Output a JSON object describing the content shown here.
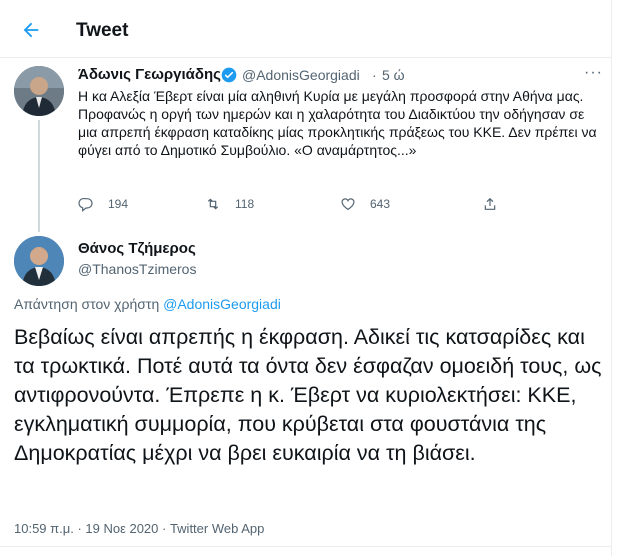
{
  "header": {
    "title": "Tweet"
  },
  "parent_tweet": {
    "display_name": "Άδωνις Γεωργιάδης",
    "handle": "@AdonisGeorgiadi",
    "separator": "·",
    "time": "5 ώ",
    "more": "···",
    "text": "Η κα Αλεξία Έβερτ είναι μία αληθινή Κυρία με μεγάλη προσφορά στην Αθήνα μας. Προφανώς η οργή των ημερών και η χαλαρότητα του Διαδικτύου την οδήγησαν σε μια απρεπή έκφραση καταδίκης μίας προκλητικής πράξεως του ΚΚΕ. Δεν πρέπει να φύγει από το Δημοτικό Συμβούλιο. «Ο αναμάρτητος...»",
    "replies": "194",
    "retweets": "118",
    "likes": "643"
  },
  "main_tweet": {
    "display_name": "Θάνος Τζήμερος",
    "handle": "@ThanosTzimeros",
    "reply_prefix": "Απάντηση στον χρήστη ",
    "reply_handle": "@AdonisGeorgiadi",
    "text": "Βεβαίως είναι απρεπής η έκφραση. Αδικεί τις κατσαρίδες και τα τρωκτικά. Ποτέ αυτά τα όντα δεν έσφαζαν ομοειδή τους, ως αντιφρονούντα. Έπρεπε η κ. Έβερτ να κυριολεκτήσει: ΚΚΕ, εγκληματική συμμορία, που κρύβεται στα φουστάνια της Δημοκρατίας μέχρι να βρει ευκαιρία να τη βιάσει.",
    "meta": "10:59 π.μ. · 19 Νοε 2020 · Twitter Web App"
  },
  "icons": {
    "back": "arrow-left-icon",
    "verified": "verified-badge-icon",
    "reply": "reply-icon",
    "retweet": "retweet-icon",
    "like": "heart-icon",
    "share": "share-icon"
  },
  "colors": {
    "accent": "#1d9bf0",
    "text_primary": "#0f1419",
    "text_secondary": "#536471",
    "border": "#ebeef0"
  }
}
